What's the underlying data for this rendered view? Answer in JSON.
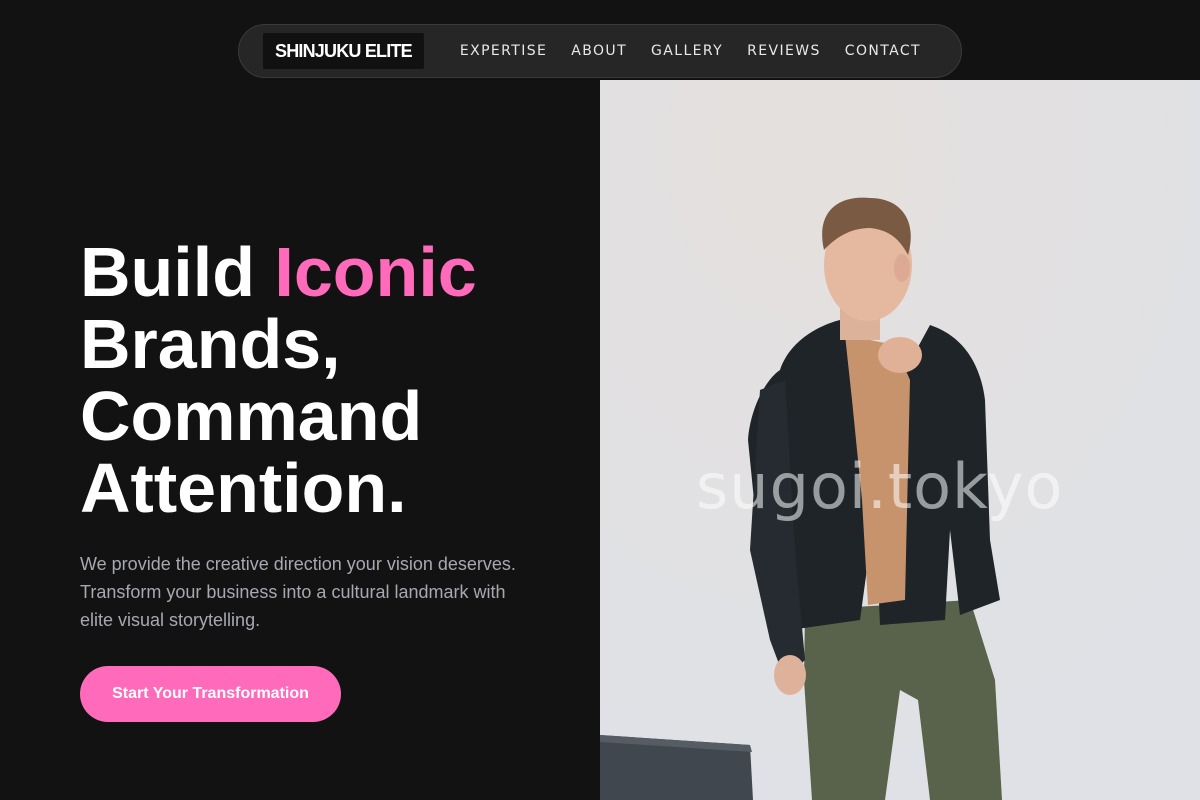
{
  "brand": {
    "logo_text": "SHINJUKU ELITE"
  },
  "nav": {
    "items": [
      {
        "label": "EXPERTISE"
      },
      {
        "label": "ABOUT"
      },
      {
        "label": "GALLERY"
      },
      {
        "label": "REVIEWS"
      },
      {
        "label": "CONTACT"
      }
    ]
  },
  "hero": {
    "title_part1": "Build ",
    "title_accent": "Iconic",
    "title_line2": "Brands,",
    "title_line3": "Command",
    "title_line4": "Attention.",
    "subtitle": "We provide the creative direction your vision deserves. Transform your business into a cultural landmark with elite visual storytelling.",
    "cta_label": "Start Your Transformation",
    "image_watermark": "sugoi.tokyo"
  },
  "colors": {
    "background": "#121212",
    "accent": "#ff6bba",
    "nav_background": "#262626",
    "subtitle_text": "#a7a9b2"
  },
  "icons": []
}
